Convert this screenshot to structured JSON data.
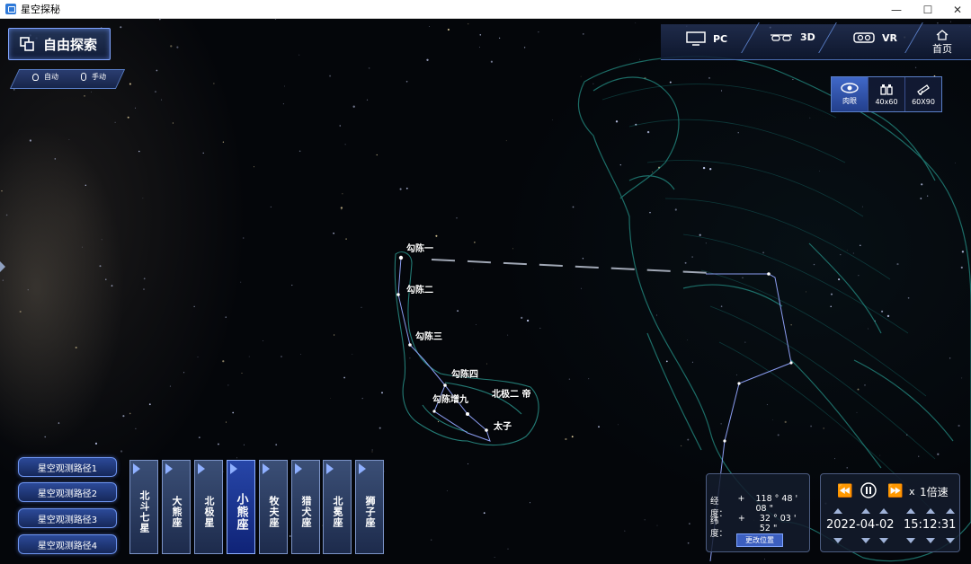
{
  "window": {
    "title": "星空探秘",
    "minimize": "—",
    "maximize": "☐",
    "close": "✕"
  },
  "explore": {
    "label": "自由探索"
  },
  "mode": {
    "auto": "自动",
    "manual": "手动"
  },
  "topbar": {
    "pc": "PC",
    "threed": "3D",
    "vr": "VR",
    "home": "首页"
  },
  "view_modes": [
    {
      "label": "肉眼",
      "icon": "eye-icon",
      "active": true
    },
    {
      "label": "40x60",
      "icon": "binoculars-icon",
      "active": false
    },
    {
      "label": "60X90",
      "icon": "telescope-icon",
      "active": false
    }
  ],
  "routes": [
    "星空观测路径1",
    "星空观测路径2",
    "星空观测路径3",
    "星空观测路径4"
  ],
  "constellations": [
    {
      "label": "北斗七星",
      "active": false
    },
    {
      "label": "大熊座",
      "active": false
    },
    {
      "label": "北极星",
      "active": false
    },
    {
      "label": "小熊座",
      "active": true
    },
    {
      "label": "牧夫座",
      "active": false
    },
    {
      "label": "猎犬座",
      "active": false
    },
    {
      "label": "北冕座",
      "active": false
    },
    {
      "label": "狮子座",
      "active": false
    }
  ],
  "coords": {
    "lon_label": "经度：",
    "lon_sign": "+",
    "lon_value": "118 ° 48 ' 08 \"",
    "lat_label": "纬度：",
    "lat_sign": "+",
    "lat_value": "32 ° 03 ' 52 \"",
    "change_button": "更改位置"
  },
  "time": {
    "speed_prefix": "x",
    "speed": "1倍速",
    "date": "2022-04-02",
    "clock": "15:12:31"
  },
  "stars": {
    "s1": "勾陈一",
    "s2": "勾陈二",
    "s3": "勾陈三",
    "s4": "勾陈四",
    "s5": "勾陈增九",
    "s6": "北极二 帝",
    "s7": "太子"
  }
}
